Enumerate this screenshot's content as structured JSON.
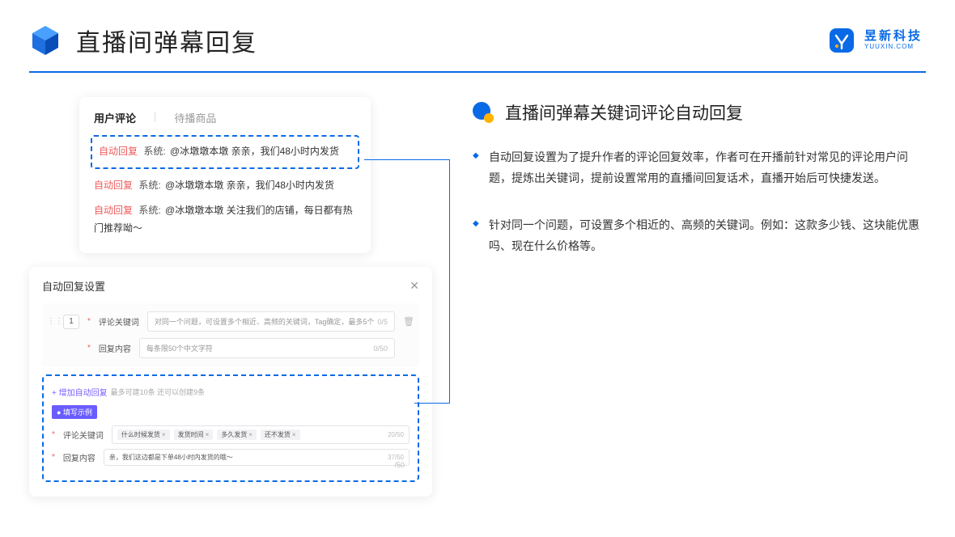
{
  "header": {
    "title": "直播间弹幕回复",
    "brand_cn": "昱新科技",
    "brand_en": "YUUXIN.COM"
  },
  "comments_card": {
    "tab_active": "用户评论",
    "tab_inactive": "待播商品",
    "highlighted": {
      "tag": "自动回复",
      "system": "系统:",
      "text": "@冰墩墩本墩 亲亲，我们48小时内发货"
    },
    "line2": {
      "tag": "自动回复",
      "system": "系统:",
      "text": "@冰墩墩本墩 亲亲，我们48小时内发货"
    },
    "line3": {
      "tag": "自动回复",
      "system": "系统:",
      "text": "@冰墩墩本墩 关注我们的店铺，每日都有热门推荐呦～"
    }
  },
  "settings_card": {
    "title": "自动回复设置",
    "row_num": "1",
    "label_keyword": "评论关键词",
    "keyword_placeholder": "对同一个问题，可设置多个相近、高频的关键词，Tag确定，最多5个",
    "keyword_counter": "0/5",
    "label_reply": "回复内容",
    "reply_placeholder": "每条限50个中文字符",
    "reply_counter": "0/50",
    "add_link": "+ 增加自动回复",
    "add_hint": "最多可建10条 还可以创建9条",
    "example_badge": "● 填写示例",
    "ex_label_kw": "评论关键词",
    "ex_chips": [
      "什么时候发货",
      "发货时间",
      "多久发货",
      "还不发货"
    ],
    "ex_kw_counter": "20/50",
    "ex_label_reply": "回复内容",
    "ex_reply_value": "亲，我们这边都是下单48小时内发货的哦～",
    "ex_reply_counter": "37/50",
    "extra_counter": "/50"
  },
  "right": {
    "section_title": "直播间弹幕关键词评论自动回复",
    "bullet1": "自动回复设置为了提升作者的评论回复效率，作者可在开播前针对常见的评论用户问题，提炼出关键词，提前设置常用的直播间回复话术，直播开始后可快捷发送。",
    "bullet2": "针对同一个问题，可设置多个相近的、高频的关键词。例如：这款多少钱、这块能优惠吗、现在什么价格等。"
  }
}
